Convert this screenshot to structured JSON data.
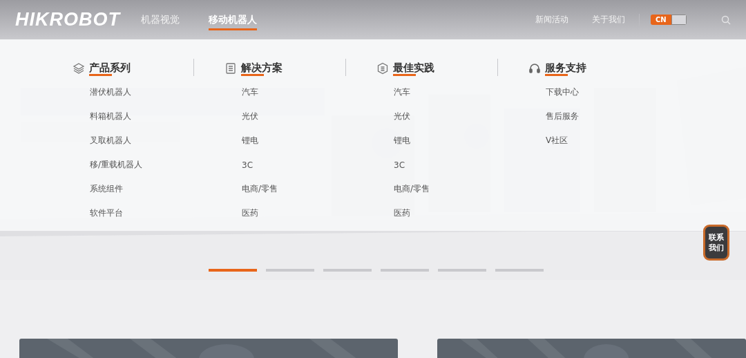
{
  "header": {
    "logo": "HIKROBOT",
    "nav": [
      {
        "label": "机器视觉",
        "selected": false
      },
      {
        "label": "移动机器人",
        "selected": true
      }
    ],
    "links": [
      "新闻活动",
      "关于我们"
    ],
    "language": "CN"
  },
  "mega_menu": {
    "columns": [
      {
        "title": "产品系列",
        "items": [
          "潜伏机器人",
          "料箱机器人",
          "叉取机器人",
          "移/重载机器人",
          "系统组件",
          "软件平台"
        ]
      },
      {
        "title": "解决方案",
        "items": [
          "汽车",
          "光伏",
          "锂电",
          "3C",
          "电商/零售",
          "医药"
        ]
      },
      {
        "title": "最佳实践",
        "items": [
          "汽车",
          "光伏",
          "锂电",
          "3C",
          "电商/零售",
          "医药"
        ]
      },
      {
        "title": "服务支持",
        "items": [
          "下载中心",
          "售后服务",
          "V社区"
        ]
      }
    ]
  },
  "carousel": {
    "slides": [
      {
        "selected": true
      },
      {
        "selected": false
      },
      {
        "selected": false
      },
      {
        "selected": false
      },
      {
        "selected": false
      },
      {
        "selected": false
      }
    ]
  },
  "contact_button": {
    "lines": [
      "联系",
      "我们"
    ]
  }
}
